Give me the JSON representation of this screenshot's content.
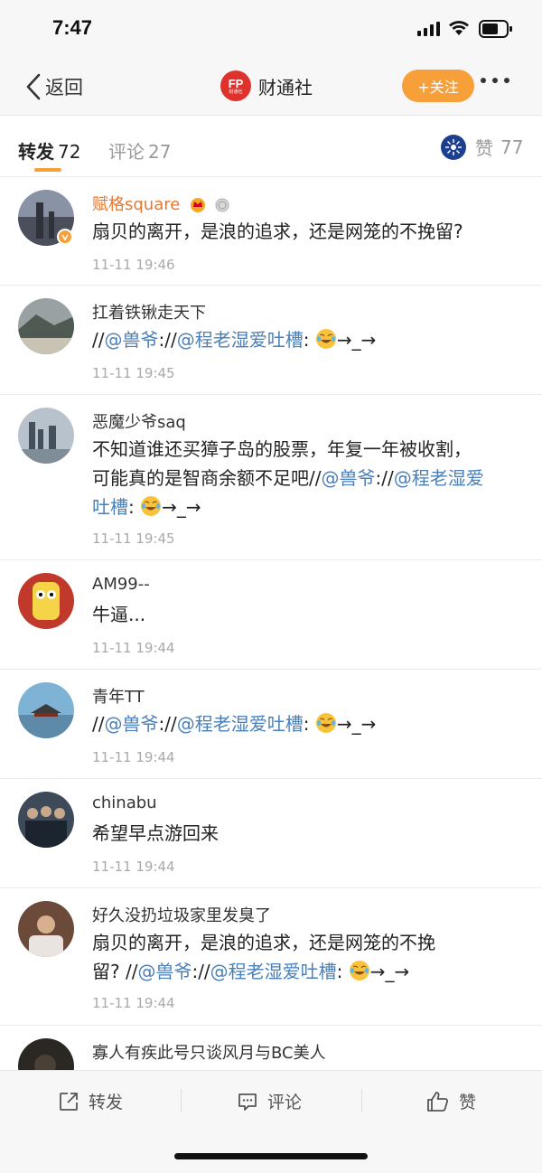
{
  "status_bar": {
    "time": "7:47"
  },
  "nav": {
    "back_label": "返回",
    "logo_text": "FP",
    "logo_sub": "财通社",
    "title": "财通社",
    "follow_label": "+关注"
  },
  "tabs": {
    "repost_label": "转发",
    "repost_count": "72",
    "comment_label": "评论",
    "comment_count": "27",
    "like_label": "赞",
    "like_count": "77"
  },
  "items": [
    {
      "name": "赋格square",
      "time": "11-11 19:46",
      "text": "扇贝的离开，是浪的追求，还是网笼的不挽留?"
    },
    {
      "name": "扛着铁锹走天下",
      "time": "11-11 19:45",
      "prefix": "//",
      "mention1": "@兽爷",
      "mid": "://",
      "mention2": "@程老湿爱吐槽",
      "suffix": ":",
      "tail": "→_→"
    },
    {
      "name": "恶魔少爷saq",
      "time": "11-11 19:45",
      "text_line1": "不知道谁还买獐子岛的股票，年复一年被收割，",
      "text_line2_pre": "可能真的是智商余额不足吧//",
      "mention1": "@兽爷",
      "mid": "://",
      "mention2a": "@程老湿爱",
      "mention2b": "吐槽",
      "suffix": ":",
      "tail": "→_→"
    },
    {
      "name": "AM99--",
      "time": "11-11 19:44",
      "text": "牛逼..."
    },
    {
      "name": "青年TT",
      "time": "11-11 19:44",
      "prefix": "//",
      "mention1": "@兽爷",
      "mid": "://",
      "mention2": "@程老湿爱吐槽",
      "suffix": ":",
      "tail": "→_→"
    },
    {
      "name": "chinabu",
      "time": "11-11 19:44",
      "text": "希望早点游回来"
    },
    {
      "name": "好久没扔垃圾家里发臭了",
      "time": "11-11 19:44",
      "text_line1": "扇贝的离开，是浪的追求，还是网笼的不挽",
      "text_line2_pre": "留? //",
      "mention1": "@兽爷",
      "mid": "://",
      "mention2": "@程老湿爱吐槽",
      "suffix": ":",
      "tail": "→_→"
    },
    {
      "name": "寡人有疾此号只谈风月与BC美人"
    }
  ],
  "toolbar": {
    "repost_label": "转发",
    "comment_label": "评论",
    "like_label": "赞"
  },
  "colors": {
    "accent": "#f7a03a",
    "mention": "#4a7fb8",
    "vip_name": "#e8772e"
  }
}
